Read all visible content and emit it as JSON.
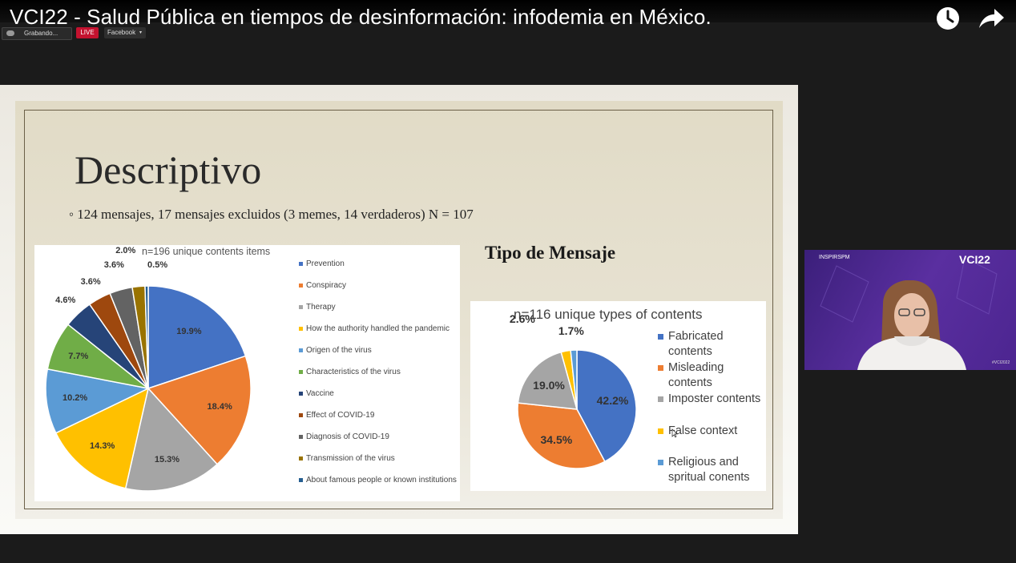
{
  "video": {
    "title": "VCI22 - Salud Pública en tiempos de desinformación: infodemia en México.",
    "recording_label": "Grabando...",
    "live_label": "LIVE",
    "platform_label": "Facebook"
  },
  "slide": {
    "title": "Descriptivo",
    "bullet": "◦  124 mensajes,  17 mensajes excluidos (3 memes, 14 verdaderos) N = 107",
    "tipo_title": "Tipo de Mensaje"
  },
  "speaker_panel": {
    "left_logo": "INSPIRSPM",
    "right_logo": "VCI22",
    "tag": "#VCI2022"
  },
  "chart_data": [
    {
      "type": "pie",
      "title": "n=196 unique contents items",
      "legend_placement": "right",
      "slices": [
        {
          "name": "Prevention",
          "value": 19.9,
          "label": "19.9%",
          "color": "#4472c4"
        },
        {
          "name": "Conspiracy",
          "value": 18.4,
          "label": "18.4%",
          "color": "#ed7d31"
        },
        {
          "name": "Therapy",
          "value": 15.3,
          "label": "15.3%",
          "color": "#a5a5a5"
        },
        {
          "name": "How the authority handled the pandemic",
          "value": 14.3,
          "label": "14.3%",
          "color": "#ffc000"
        },
        {
          "name": "Origen of the virus",
          "value": 10.2,
          "label": "10.2%",
          "color": "#5b9bd5"
        },
        {
          "name": "Characteristics of the virus",
          "value": 7.7,
          "label": "7.7%",
          "color": "#70ad47"
        },
        {
          "name": "Vaccine",
          "value": 4.6,
          "label": "4.6%",
          "color": "#264478"
        },
        {
          "name": "Effect of COVID-19",
          "value": 3.6,
          "label": "3.6%",
          "color": "#9e480e"
        },
        {
          "name": "Diagnosis of COVID-19",
          "value": 3.6,
          "label": "3.6%",
          "color": "#636363"
        },
        {
          "name": "Transmission of the virus",
          "value": 2.0,
          "label": "2.0%",
          "color": "#997300"
        },
        {
          "name": "About famous people or known institutions",
          "value": 0.5,
          "label": "0.5%",
          "color": "#255e91"
        }
      ]
    },
    {
      "type": "pie",
      "title": "n=116 unique types of contents",
      "legend_placement": "right",
      "slices": [
        {
          "name": "Fabricated contents",
          "value": 42.2,
          "label": "42.2%",
          "color": "#4472c4"
        },
        {
          "name": "Misleading contents",
          "value": 34.5,
          "label": "34.5%",
          "color": "#ed7d31"
        },
        {
          "name": "Imposter contents",
          "value": 19.0,
          "label": "19.0%",
          "color": "#a5a5a5"
        },
        {
          "name": "False context",
          "value": 2.6,
          "label": "2.6%",
          "color": "#ffc000"
        },
        {
          "name": "Religious and spritual conents",
          "value": 1.7,
          "label": "1.7%",
          "color": "#5b9bd5"
        }
      ]
    }
  ]
}
